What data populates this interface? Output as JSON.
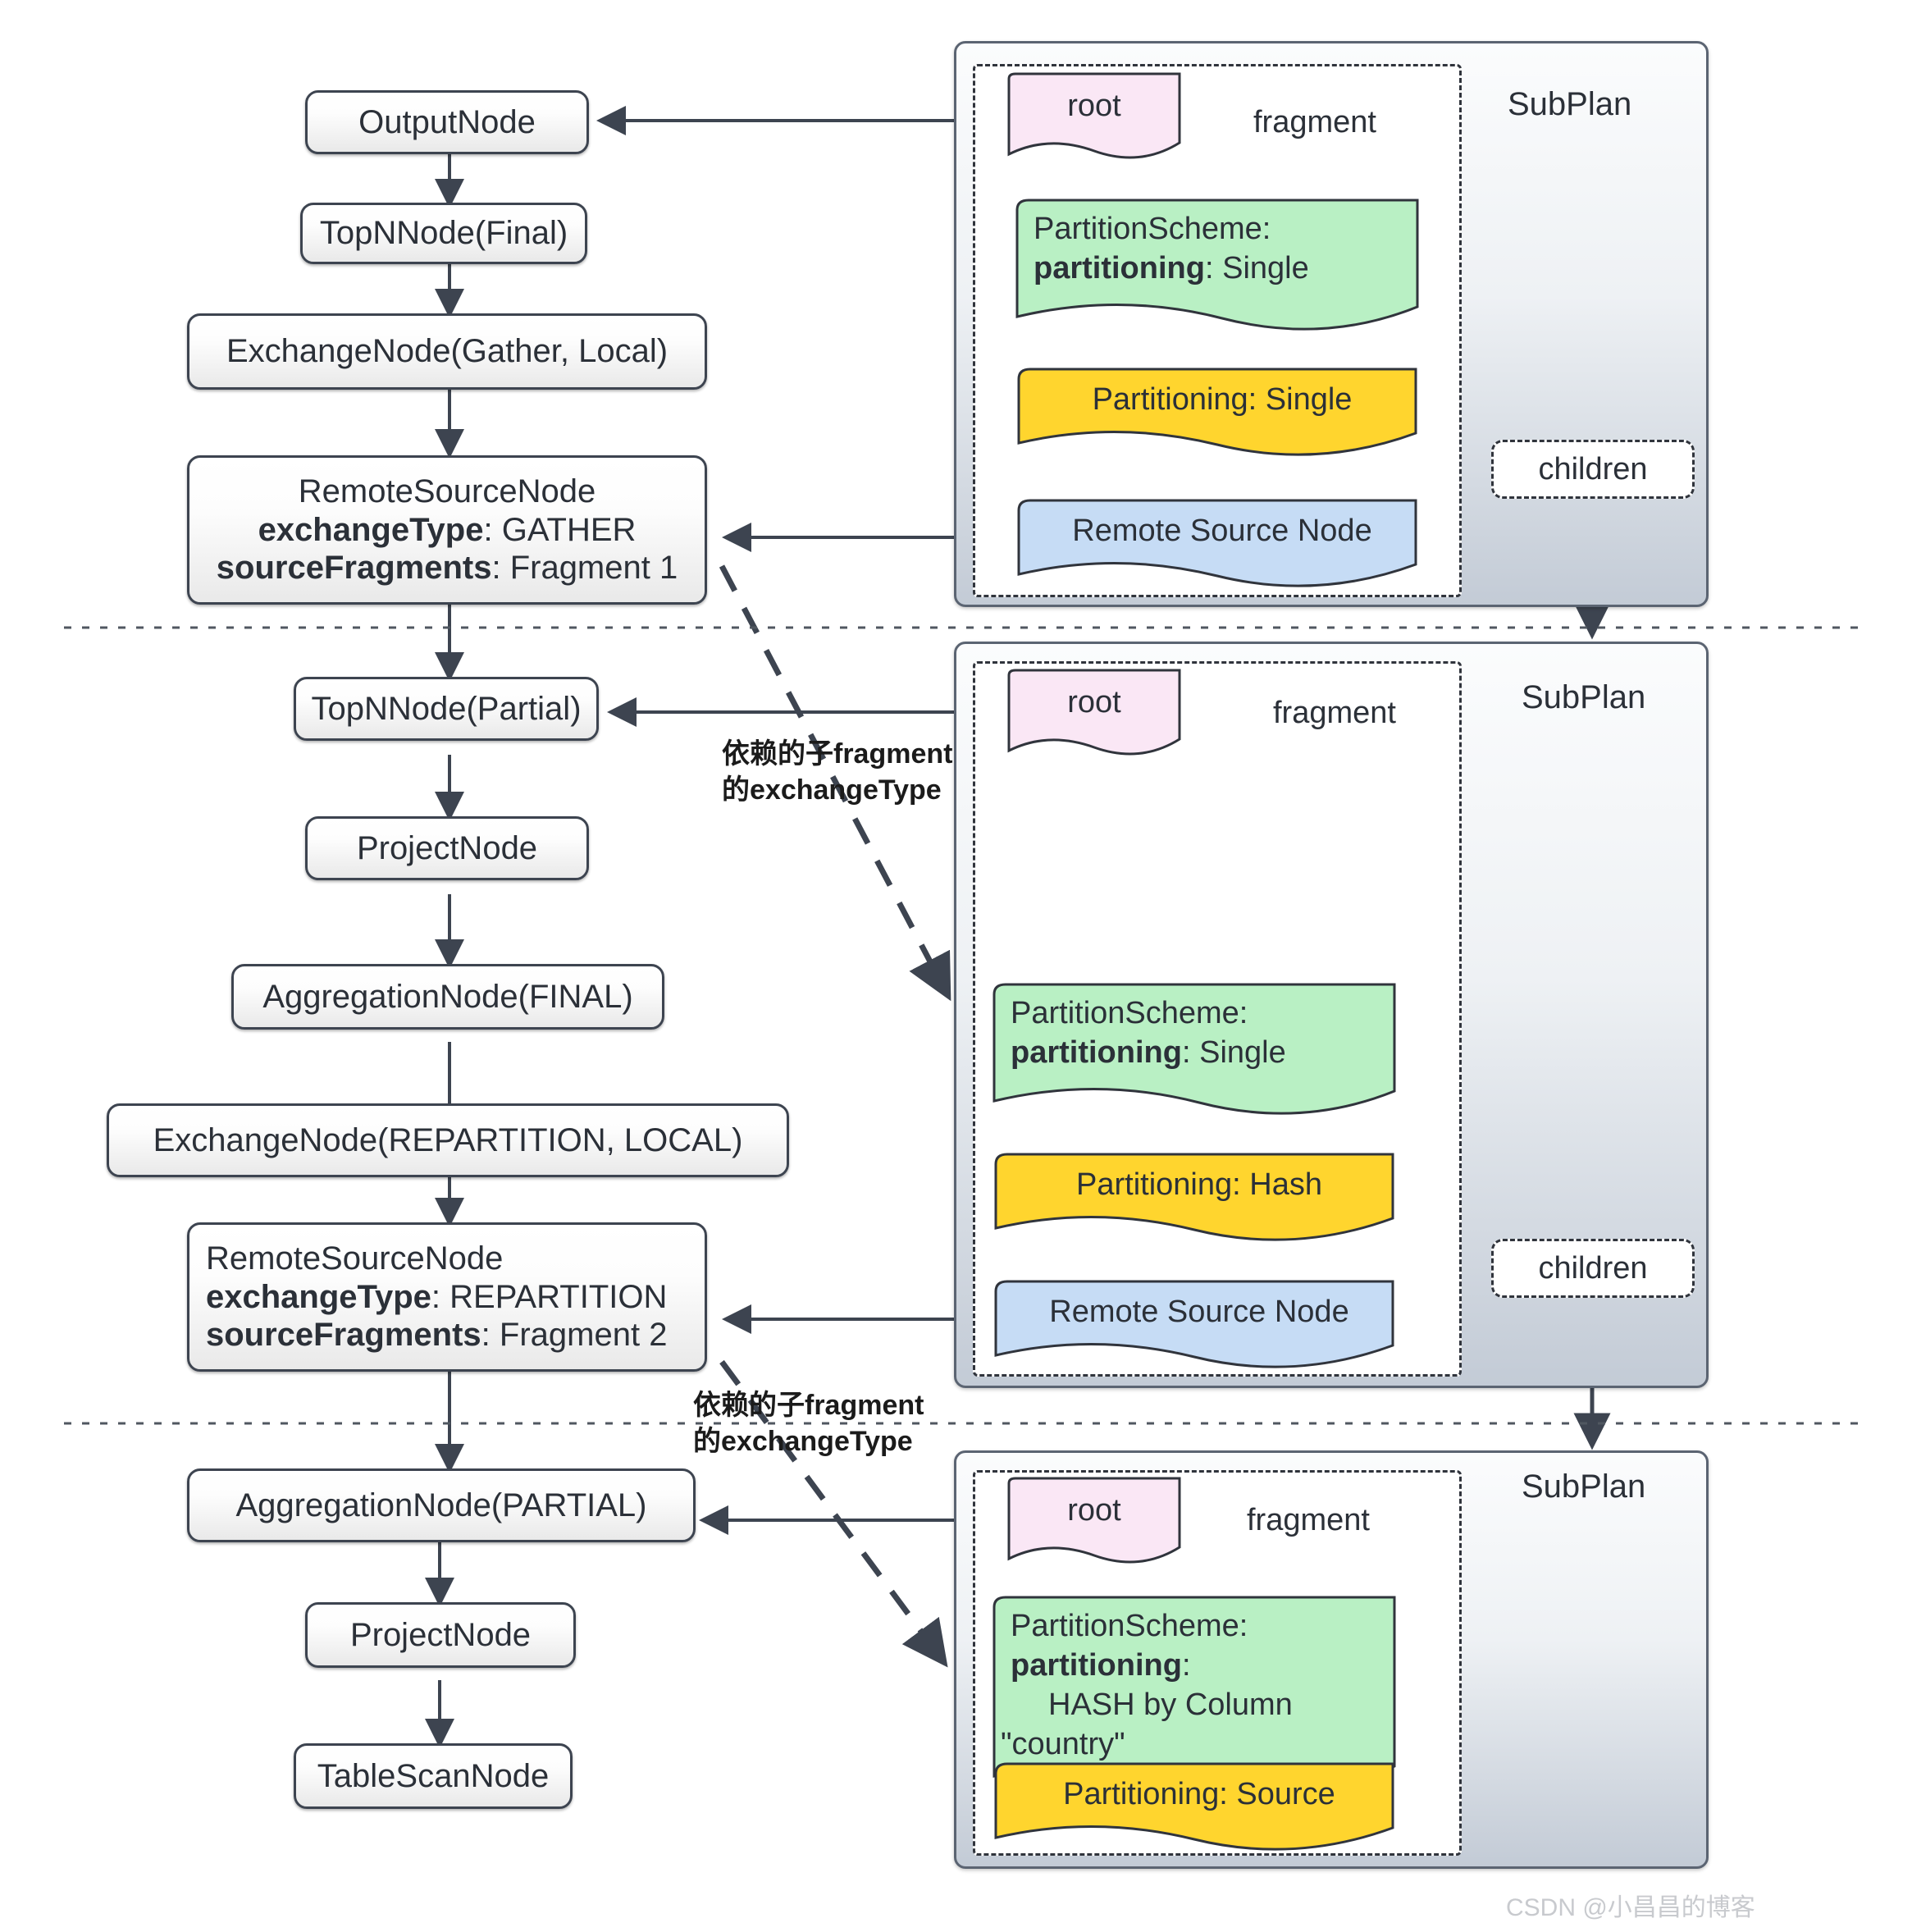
{
  "colors": {
    "root_fill": "#fae7f5",
    "scheme_fill": "#b9f0c4",
    "partitioning_fill": "#ffd52e",
    "remote_fill": "#c6dcf5",
    "node_stroke": "#3d4450",
    "subplan_stroke": "#5b6472",
    "text": "#2b3038"
  },
  "plan_nodes": [
    {
      "id": "output",
      "label": "OutputNode"
    },
    {
      "id": "topn_final",
      "label": "TopNNode(Final)"
    },
    {
      "id": "exchange_gather",
      "label": "ExchangeNode(Gather, Local)"
    },
    {
      "id": "remote_1_title",
      "label": "RemoteSourceNode",
      "line2_key": "exchangeType",
      "line2_val": "GATHER",
      "line3_key": "sourceFragments",
      "line3_val": "Fragment 1"
    },
    {
      "id": "topn_partial",
      "label": "TopNNode(Partial)"
    },
    {
      "id": "project_mid",
      "label": "ProjectNode"
    },
    {
      "id": "agg_final",
      "label": "AggregationNode(FINAL)"
    },
    {
      "id": "exchange_repartition",
      "label": "ExchangeNode(REPARTITION, LOCAL)"
    },
    {
      "id": "remote_2_title",
      "label": "RemoteSourceNode",
      "line2_key": "exchangeType",
      "line2_val": "REPARTITION",
      "line3_key": "sourceFragments",
      "line3_val": "Fragment 2"
    },
    {
      "id": "agg_partial",
      "label": "AggregationNode(PARTIAL)"
    },
    {
      "id": "project_bottom",
      "label": "ProjectNode"
    },
    {
      "id": "table_scan",
      "label": "TableScanNode"
    }
  ],
  "subplans": [
    {
      "id": "subplan-1",
      "title": "SubPlan",
      "fragment_label": "fragment",
      "root_label": "root",
      "scheme_line1": "PartitionScheme:",
      "scheme_key": "partitioning",
      "scheme_val": "Single",
      "partitioning_label": "Partitioning: Single",
      "remote_label": "Remote Source Node",
      "children_label": "children"
    },
    {
      "id": "subplan-2",
      "title": "SubPlan",
      "fragment_label": "fragment",
      "root_label": "root",
      "scheme_line1": "PartitionScheme:",
      "scheme_key": "partitioning",
      "scheme_val": "Single",
      "partitioning_label": "Partitioning: Hash",
      "remote_label": "Remote Source Node",
      "children_label": "children"
    },
    {
      "id": "subplan-3",
      "title": "SubPlan",
      "fragment_label": "fragment",
      "root_label": "root",
      "scheme_line1": "PartitionScheme:",
      "scheme_key": "partitioning",
      "scheme_val": "",
      "scheme_extra_line1": "HASH by Column",
      "scheme_extra_line2": "\"country\"",
      "partitioning_label": "Partitioning: Source",
      "remote_label": "",
      "children_label": ""
    }
  ],
  "annotations": {
    "note_1": "依赖的子fragment\n的exchangeType",
    "note_2": "依赖的子fragment\n的exchangeType"
  },
  "watermark": "CSDN @小昌昌的博客"
}
